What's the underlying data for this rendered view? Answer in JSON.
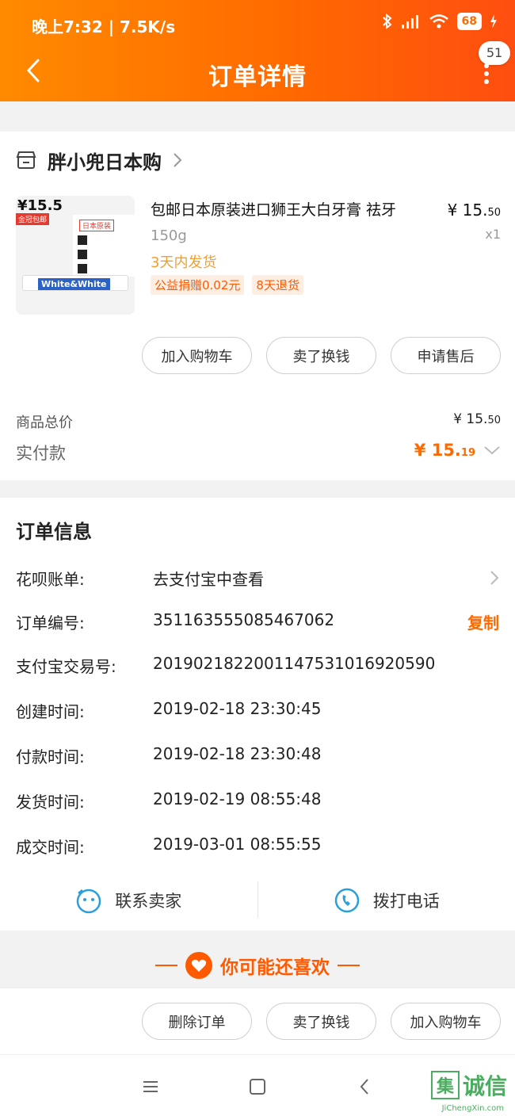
{
  "status_bar": {
    "time_speed": "晚上7:32 | 7.5K/s",
    "battery": "68"
  },
  "header": {
    "title": "订单详情",
    "badge_count": "51"
  },
  "store": {
    "name": "胖小兜日本购",
    "product": {
      "title": "包邮日本原装进口狮王大白牙膏 祛牙",
      "spec": "150g",
      "ship": "3天内发货",
      "tags": [
        "公益捐赠0.02元",
        "8天退货"
      ],
      "price_int": "¥ 15.",
      "price_dec": "50",
      "qty": "x1",
      "thumb_price": "¥15.5",
      "thumb_tag": "金冠包邮",
      "thumb_box_title": "日本原装",
      "thumb_brand": "White&White"
    },
    "buttons": [
      "加入购物车",
      "卖了换钱",
      "申请售后"
    ],
    "total_label": "商品总价",
    "total_int": "¥ 15.",
    "total_dec": "50",
    "paid_label": "实付款",
    "paid_int": "¥ 15.",
    "paid_dec": "19"
  },
  "order_info": {
    "title": "订单信息",
    "rows": [
      {
        "key": "花呗账单:",
        "value": "去支付宝中查看"
      },
      {
        "key": "订单编号:",
        "value": "351163555085467062",
        "action": "复制"
      },
      {
        "key": "支付宝交易号:",
        "value": "2019021822001147531016920590"
      },
      {
        "key": "创建时间:",
        "value": "2019-02-18 23:30:45"
      },
      {
        "key": "付款时间:",
        "value": "2019-02-18 23:30:48"
      },
      {
        "key": "发货时间:",
        "value": "2019-02-19 08:55:48"
      },
      {
        "key": "成交时间:",
        "value": "2019-03-01 08:55:55"
      }
    ],
    "contact_seller": "联系卖家",
    "call_phone": "拨打电话"
  },
  "recommend": {
    "label": "你可能还喜欢"
  },
  "bottom_buttons": [
    "删除订单",
    "卖了换钱",
    "加入购物车"
  ],
  "watermark": {
    "text": "诚信",
    "box": "集",
    "url": "JiChengXin.com"
  },
  "colors": {
    "accent": "#ff6a00",
    "header_start": "#ff8a00",
    "header_end": "#ff4e10"
  }
}
